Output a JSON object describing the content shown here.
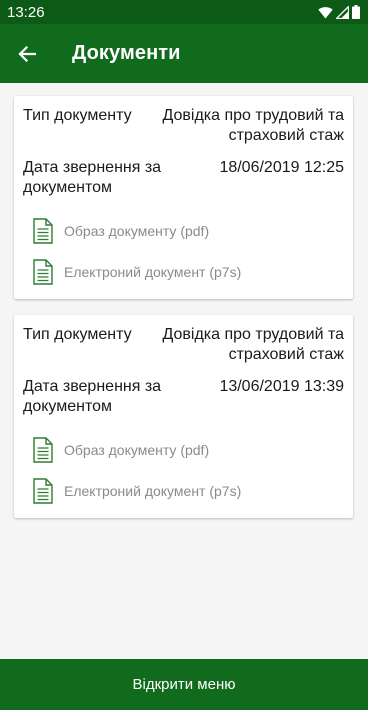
{
  "status_bar": {
    "time": "13:26"
  },
  "app_bar": {
    "title": "Документи"
  },
  "documents": [
    {
      "type_label": "Тип документу",
      "type_value": "Довідка про трудовий та страховий стаж",
      "date_label": "Дата звернення за документом",
      "date_value": "18/06/2019 12:25",
      "pdf_label": "Образ документу (pdf)",
      "p7s_label": "Електроний документ (p7s)"
    },
    {
      "type_label": "Тип документу",
      "type_value": "Довідка про трудовий та страховий стаж",
      "date_label": "Дата звернення за документом",
      "date_value": "13/06/2019 13:39",
      "pdf_label": "Образ документу (pdf)",
      "p7s_label": "Електроний документ (p7s)"
    }
  ],
  "footer": {
    "menu_button_label": "Відкрити меню"
  },
  "colors": {
    "primary": "#106b1c",
    "status_bar": "#0c5a16",
    "icon_green": "#2e7d32"
  }
}
